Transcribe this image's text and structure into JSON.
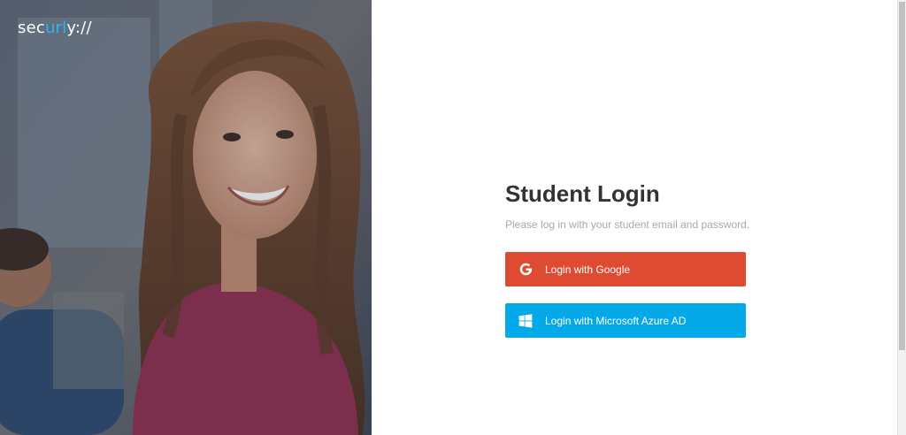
{
  "brand": {
    "logo_prefix": "sec",
    "logo_accent": "url",
    "logo_suffix": "y://",
    "accent_color": "#29b6f6"
  },
  "hero": {
    "image": "student-smiling-photo"
  },
  "login": {
    "title": "Student Login",
    "subtitle": "Please log in with your student email and password.",
    "buttons": [
      {
        "label": "Login with Google",
        "icon": "google-icon",
        "color": "#df4a32"
      },
      {
        "label": "Login with Microsoft Azure AD",
        "icon": "windows-icon",
        "color": "#03a9e8"
      }
    ]
  }
}
